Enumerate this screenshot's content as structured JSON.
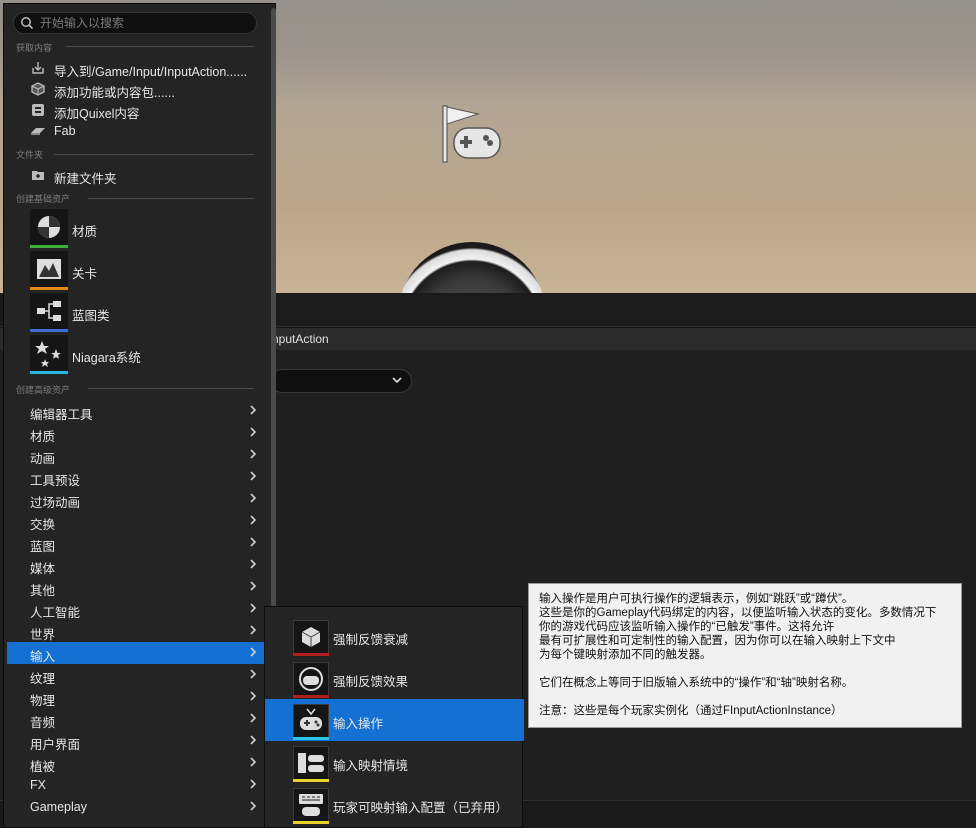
{
  "search": {
    "placeholder": "开始输入以搜索"
  },
  "sections": {
    "get_content": "获取内容",
    "folder": "文件夹",
    "basic_assets": "创建基础资产",
    "advanced_assets": "创建高级资产"
  },
  "get_content_items": [
    {
      "label": "导入到/Game/Input/InputAction......",
      "icon": "import-icon"
    },
    {
      "label": "添加功能或内容包......",
      "icon": "feature-pack-icon"
    },
    {
      "label": "添加Quixel内容",
      "icon": "quixel-icon"
    },
    {
      "label": "Fab",
      "icon": "fab-icon"
    }
  ],
  "folder_items": [
    {
      "label": "新建文件夹",
      "icon": "new-folder-icon"
    }
  ],
  "basic_assets": [
    {
      "label": "材质",
      "icon": "material-icon",
      "color": "#3fae3f"
    },
    {
      "label": "关卡",
      "icon": "level-icon",
      "color": "#e08a1e"
    },
    {
      "label": "蓝图类",
      "icon": "blueprint-class-icon",
      "color": "#3d6fd8"
    },
    {
      "label": "Niagara系统",
      "icon": "niagara-system-icon",
      "color": "#27b6e0"
    }
  ],
  "advanced_categories": [
    {
      "label": "编辑器工具"
    },
    {
      "label": "材质"
    },
    {
      "label": "动画"
    },
    {
      "label": "工具预设"
    },
    {
      "label": "过场动画"
    },
    {
      "label": "交换"
    },
    {
      "label": "蓝图"
    },
    {
      "label": "媒体"
    },
    {
      "label": "其他"
    },
    {
      "label": "人工智能"
    },
    {
      "label": "世界"
    },
    {
      "label": "输入",
      "selected": true
    },
    {
      "label": "纹理"
    },
    {
      "label": "物理"
    },
    {
      "label": "音频"
    },
    {
      "label": "用户界面"
    },
    {
      "label": "植被"
    },
    {
      "label": "FX"
    },
    {
      "label": "Gameplay"
    }
  ],
  "input_submenu": [
    {
      "label": "强制反馈衰减",
      "icon": "force-feedback-attenuation-icon",
      "color": "#b01e1e"
    },
    {
      "label": "强制反馈效果",
      "icon": "force-feedback-effect-icon",
      "color": "#b01e1e"
    },
    {
      "label": "输入操作",
      "icon": "input-action-icon",
      "color": "#29c3e8",
      "selected": true
    },
    {
      "label": "输入映射情境",
      "icon": "input-mapping-context-icon",
      "color": "#e8d229"
    },
    {
      "label": "玩家可映射输入配置（已弃用）",
      "icon": "player-mappable-input-config-icon",
      "color": "#e8d229"
    }
  ],
  "tooltip": {
    "lines": [
      "输入操作是用户可执行操作的逻辑表示，例如“跳跃”或“蹲伏”。",
      "这些是你的Gameplay代码绑定的内容，以便监听输入状态的变化。多数情况下",
      "你的游戏代码应该监听输入操作的“已触发”事件。这将允许",
      "最有可扩展性和可定制性的输入配置，因为你可以在输入映射上下文中",
      "为每个键映射添加不同的触发器。"
    ],
    "paragraph2": "它们在概念上等同于旧版输入系统中的“操作”和“轴”映射名称。",
    "note": "注意：这些是每个玩家实例化（通过FInputActionInstance）"
  },
  "editor": {
    "asset_path_fragment": "nputAction"
  },
  "colors": {
    "accent": "#1470d2",
    "menu_bg": "#242424",
    "tooltip_bg": "#f1f1f1"
  }
}
